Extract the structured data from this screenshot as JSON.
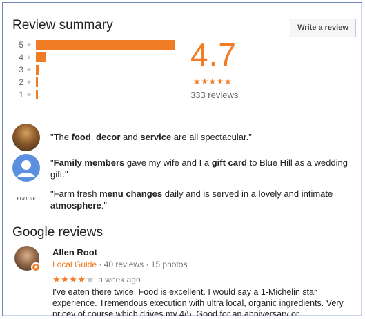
{
  "summary": {
    "title": "Review summary",
    "write_button": "Write a review",
    "rating": "4.7",
    "stars": "★★★★★",
    "count": "333 reviews",
    "distribution": [
      {
        "label": "5",
        "star": "★",
        "fraction": 0.91
      },
      {
        "label": "4",
        "star": "★",
        "fraction": 0.065
      },
      {
        "label": "3",
        "star": "★",
        "fraction": 0.02
      },
      {
        "label": "2",
        "star": "★",
        "fraction": 0.013
      },
      {
        "label": "1",
        "star": "★",
        "fraction": 0.013
      }
    ]
  },
  "snippets": [
    {
      "parts": [
        [
          "\"The ",
          0
        ],
        [
          "food",
          1
        ],
        [
          ", ",
          0
        ],
        [
          "decor",
          1
        ],
        [
          " and ",
          0
        ],
        [
          "service",
          1
        ],
        [
          " are all spectacular.\"",
          0
        ]
      ]
    },
    {
      "parts": [
        [
          "\"",
          0
        ],
        [
          "Family members",
          1
        ],
        [
          " gave my wife and I a ",
          0
        ],
        [
          "gift card",
          1
        ],
        [
          " to Blue Hill as a wedding gift.\"",
          0
        ]
      ]
    },
    {
      "logo_text": "FOODIE",
      "parts": [
        [
          "\"Farm fresh ",
          0
        ],
        [
          "menu changes",
          1
        ],
        [
          " daily and is served in a lovely and intimate ",
          0
        ],
        [
          "atmosphere",
          1
        ],
        [
          ".\"",
          0
        ]
      ]
    }
  ],
  "google_reviews": {
    "title": "Google reviews",
    "reviewer": {
      "name": "Allen Root",
      "badge": "Local Guide",
      "meta": " · 40 reviews · 15 photos",
      "stars_filled": "★★★★",
      "stars_empty": "★",
      "rating": 4,
      "date": "a week ago",
      "body": "I've eaten there twice. Food is excellent.  I would say a 1-Michelin star experience.  Tremendous execution with ultra local, organic ingredients.  Very pricey of course which drives my 4/5.  Good for an anniversary or"
    }
  },
  "colors": {
    "accent": "#f07c25",
    "frame": "#6f88b8"
  }
}
